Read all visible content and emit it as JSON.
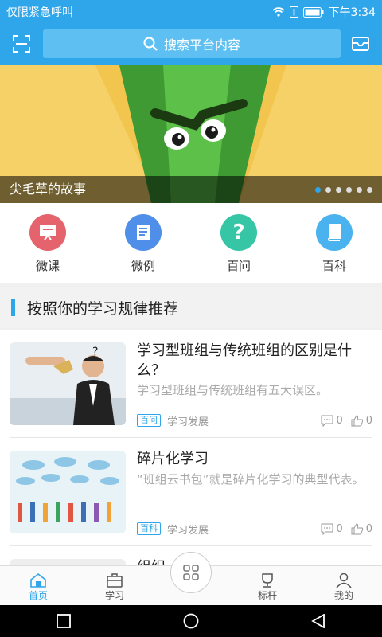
{
  "status_bar": {
    "carrier": "仅限紧急呼叫",
    "time": "下午3:34"
  },
  "header": {
    "search_placeholder": "搜索平台内容",
    "scan_icon": "scan-icon",
    "mail_icon": "mail-icon"
  },
  "banner": {
    "caption": "尖毛草的故事",
    "slide_count": 6,
    "active_slide": 1
  },
  "quick_nav": [
    {
      "label": "微课",
      "icon": "video-lesson-icon",
      "color": "#e5636c"
    },
    {
      "label": "微例",
      "icon": "case-book-icon",
      "color": "#4f8ee9"
    },
    {
      "label": "百问",
      "icon": "question-icon",
      "color": "#36c6a6"
    },
    {
      "label": "百科",
      "icon": "encyclopedia-icon",
      "color": "#4ab3ef"
    }
  ],
  "section": {
    "title": "按照你的学习规律推荐"
  },
  "articles": [
    {
      "title": "学习型班组与传统班组的区别是什么？",
      "summary": "学习型班组与传统班组有五大误区。",
      "tag": "百问",
      "category": "学习发展",
      "comments": "0",
      "likes": "0"
    },
    {
      "title": "碎片化学习",
      "summary": "“班组云书包”就是碎片化学习的典型代表。",
      "tag": "百科",
      "category": "学习发展",
      "comments": "0",
      "likes": "0"
    },
    {
      "title": "组织"
    }
  ],
  "tabbar": {
    "tabs": [
      {
        "label": "首页",
        "icon": "home-icon"
      },
      {
        "label": "学习",
        "icon": "briefcase-icon"
      },
      {
        "label": "标杆",
        "icon": "trophy-icon"
      },
      {
        "label": "我的",
        "icon": "user-icon"
      }
    ],
    "center_icon": "grid-menu-icon"
  },
  "colors": {
    "brand": "#2fa6ea"
  }
}
